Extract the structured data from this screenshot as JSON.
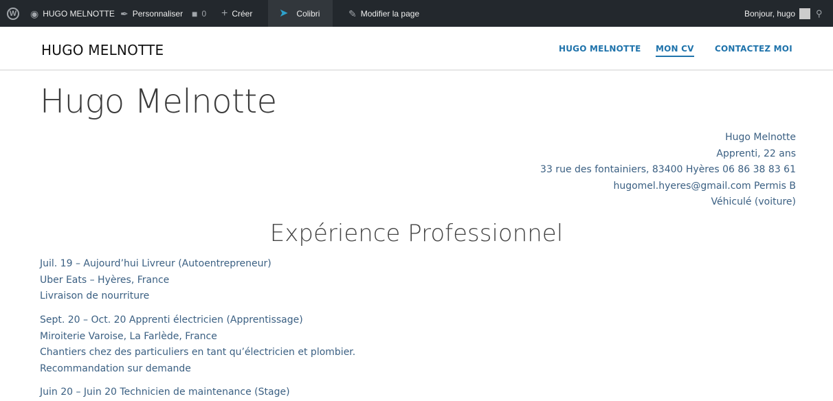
{
  "adminbar": {
    "site_name": "HUGO MELNOTTE",
    "customize": "Personnaliser",
    "comments_count": "0",
    "new": "Créer",
    "colibri": "Colibri",
    "edit_page": "Modifier la page",
    "greeting": "Bonjour, hugo"
  },
  "header": {
    "site_title": "HUGO MELNOTTE",
    "nav": [
      "HUGO MELNOTTE",
      "MON CV",
      "CONTACTEZ MOI"
    ],
    "active_nav": "MON CV"
  },
  "page": {
    "title": "Hugo Melnotte",
    "contact": [
      "Hugo Melnotte",
      "Apprenti, 22 ans",
      "33 rue des fontainiers, 83400 Hyères 06 86 38 83 61",
      "hugomel.hyeres@gmail.com Permis B",
      "Véhiculé (voiture)"
    ],
    "section_title": "Expérience Professionnel",
    "experiences": [
      {
        "line1": "Juil. 19 – Aujourd’hui Livreur (Autoentrepreneur)",
        "line2": "Uber Eats – Hyères, France",
        "line3": "Livraison de nourriture"
      },
      {
        "line1": "Sept. 20 – Oct. 20 Apprenti électricien (Apprentissage)",
        "line2": "Miroiterie Varoise, La Farlède, France",
        "line3": "Chantiers chez des particuliers en tant qu’électricien et plombier.",
        "line4": "Recommandation sur demande"
      }
    ],
    "partial_line": "Juin 20 – Juin 20 Technicien de maintenance (Stage)"
  },
  "colors": {
    "adminbar_bg": "#23282d",
    "link_blue": "#1f73ab",
    "text_blue": "#3a5f82"
  }
}
